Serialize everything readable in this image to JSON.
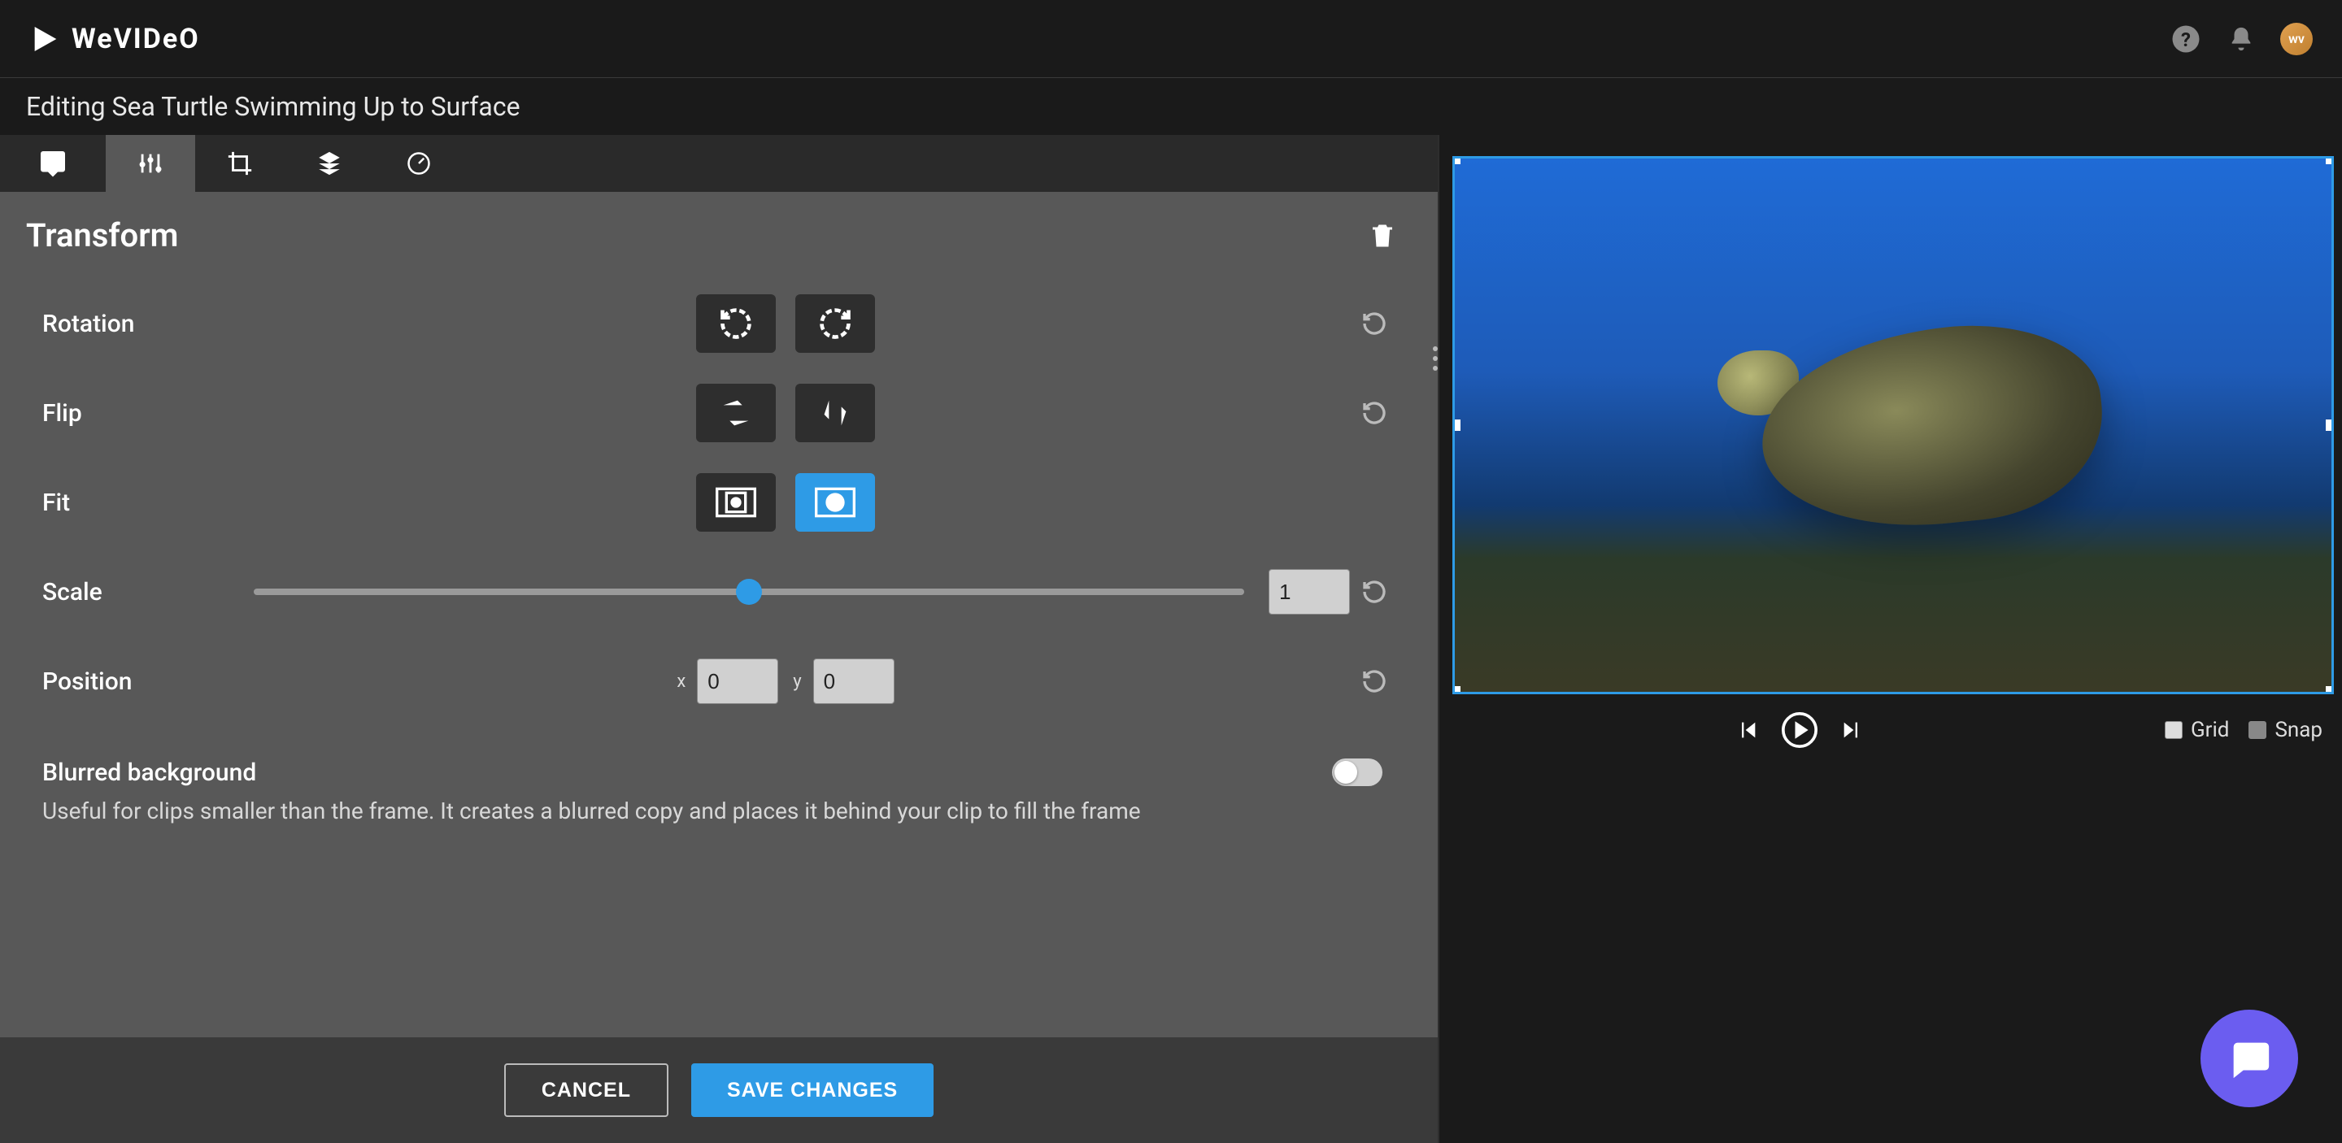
{
  "app": {
    "name": "WeVideo",
    "avatar_initials": "wv"
  },
  "title_bar": {
    "prefix": "Editing",
    "clip_name": "Sea Turtle Swimming Up to Surface",
    "full": "Editing Sea Turtle Swimming Up to Surface"
  },
  "tabs": [
    {
      "id": "comments",
      "icon": "comment-icon"
    },
    {
      "id": "adjust",
      "icon": "sliders-icon",
      "active": true
    },
    {
      "id": "crop",
      "icon": "crop-icon"
    },
    {
      "id": "layers",
      "icon": "layers-icon"
    },
    {
      "id": "color",
      "icon": "gauge-icon"
    }
  ],
  "panel": {
    "title": "Transform",
    "controls": {
      "rotation": {
        "label": "Rotation"
      },
      "flip": {
        "label": "Flip"
      },
      "fit": {
        "label": "Fit",
        "selected": "fill"
      },
      "scale": {
        "label": "Scale",
        "value": "1",
        "min": 0,
        "max": 2
      },
      "position": {
        "label": "Position",
        "x_label": "x",
        "y_label": "y",
        "x": "0",
        "y": "0"
      },
      "blurred_bg": {
        "title": "Blurred background",
        "description": "Useful for clips smaller than the frame. It creates a blurred copy and places it behind your clip to fill the frame",
        "enabled": false
      }
    },
    "buttons": {
      "cancel": "CANCEL",
      "save": "SAVE CHANGES"
    }
  },
  "preview": {
    "grid_label": "Grid",
    "snap_label": "Snap",
    "grid_checked": false,
    "snap_checked": false
  },
  "colors": {
    "accent": "#2e9be6",
    "chat": "#6b5df0"
  }
}
